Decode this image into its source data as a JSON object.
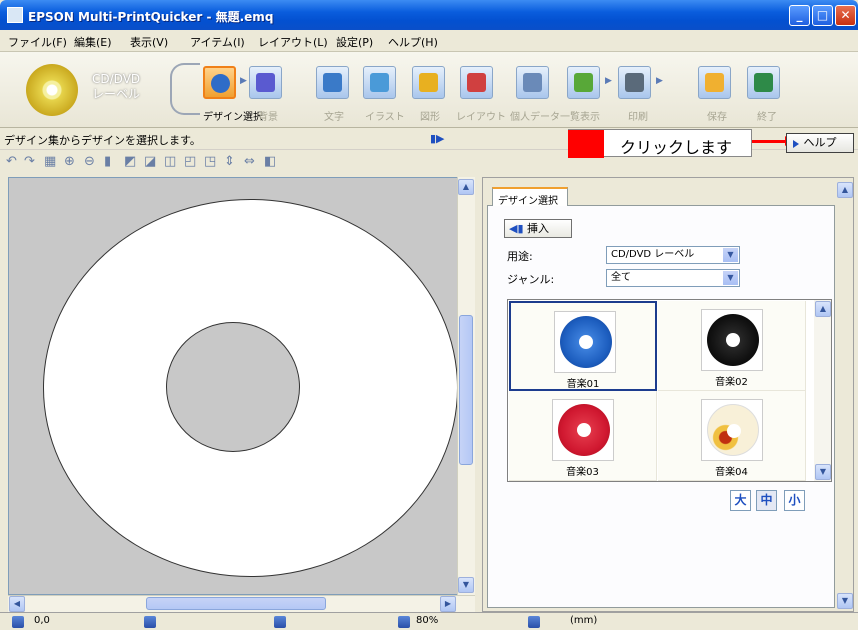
{
  "window": {
    "title": "EPSON Multi-PrintQuicker - 無題.emq"
  },
  "menu": [
    "ファイル(F)",
    "編集(E)",
    "表示(V)",
    "アイテム(I)",
    "レイアウト(L)",
    "設定(P)",
    "ヘルプ(H)"
  ],
  "product": {
    "label_line1": "CD/DVD",
    "label_line2": "レーベル"
  },
  "toolbar": {
    "steps": [
      {
        "label": "デザイン選択",
        "icon": "design-select-icon",
        "color": "#2e6cc8"
      },
      {
        "label": "背景",
        "icon": "background-icon",
        "color": "#5a5ad0"
      },
      {
        "label": "文字",
        "icon": "text-icon",
        "color": "#3a7ac8"
      },
      {
        "label": "イラスト",
        "icon": "illustration-icon",
        "color": "#4a9ad8"
      },
      {
        "label": "図形",
        "icon": "shape-icon",
        "color": "#e8b020"
      },
      {
        "label": "レイアウト",
        "icon": "layout-icon",
        "color": "#d04040"
      },
      {
        "label": "個人データ一覧表示",
        "icon": "personal-data-icon",
        "color": "#6a8ab8"
      },
      {
        "label": "",
        "icon": "list-view-icon",
        "color": "#58a838"
      },
      {
        "label": "印刷",
        "icon": "print-icon",
        "color": "#5a6a7a"
      },
      {
        "label": "保存",
        "icon": "save-icon",
        "color": "#f0b030"
      },
      {
        "label": "終了",
        "icon": "exit-icon",
        "color": "#2e8a48"
      }
    ]
  },
  "status": {
    "message": "デザイン集からデザインを選択します。"
  },
  "callout": {
    "text": "クリックします"
  },
  "help_button": {
    "label": "ヘルプ"
  },
  "design_panel": {
    "tab_label": "デザイン選択",
    "insert_label": "挿入",
    "usage_label": "用途:",
    "usage_value": "CD/DVD レーベル",
    "genre_label": "ジャンル:",
    "genre_value": "全て",
    "thumbnails": [
      {
        "caption": "音楽01",
        "color": "#1e5fc0",
        "selected": true
      },
      {
        "caption": "音楽02",
        "color": "#111111",
        "selected": false
      },
      {
        "caption": "音楽03",
        "color": "#d01830",
        "selected": false
      },
      {
        "caption": "音楽04",
        "color": "#f4e8c0",
        "selected": false
      }
    ],
    "size_buttons": [
      "大",
      "中",
      "小"
    ],
    "size_selected": "中"
  },
  "bottom_status": {
    "coord1": "0,0",
    "zoom": "80%",
    "unit": "(mm)"
  }
}
